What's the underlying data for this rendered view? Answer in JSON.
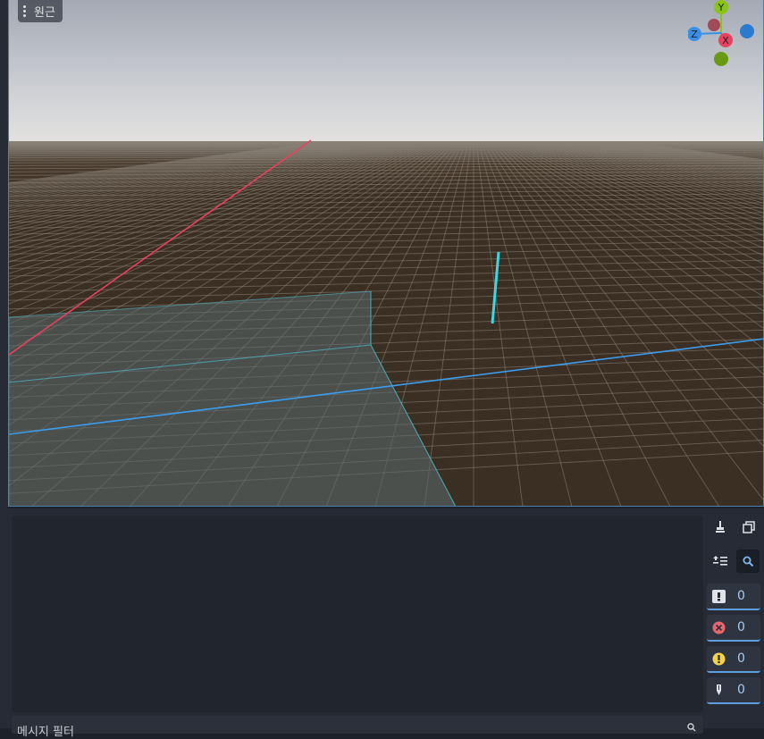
{
  "viewport": {
    "perspective_label": "원근",
    "gizmo": {
      "y_label": "Y",
      "x_label": "X",
      "z_label": "Z"
    }
  },
  "output_panel": {
    "filter_placeholder": "메시지 필터",
    "toolbar": {
      "clear_icon": "broom-icon",
      "copy_icon": "copy-icon",
      "collapse_icon": "collapse-lines-icon",
      "search_icon": "search-icon"
    },
    "counters": [
      {
        "name": "standard-messages",
        "icon": "exclamation-box-icon",
        "count": "0"
      },
      {
        "name": "errors",
        "icon": "error-circle-icon",
        "count": "0",
        "color": "#e8666e"
      },
      {
        "name": "warnings",
        "icon": "warning-circle-icon",
        "count": "0",
        "color": "#f2d24c"
      },
      {
        "name": "editor-messages",
        "icon": "pen-icon",
        "count": "0"
      }
    ]
  },
  "colors": {
    "x_axis": "#e8415f",
    "y_axis": "#8ac414",
    "z_axis": "#3a8fe6",
    "accent": "#5e9de0",
    "ground": "#3b2e22"
  }
}
